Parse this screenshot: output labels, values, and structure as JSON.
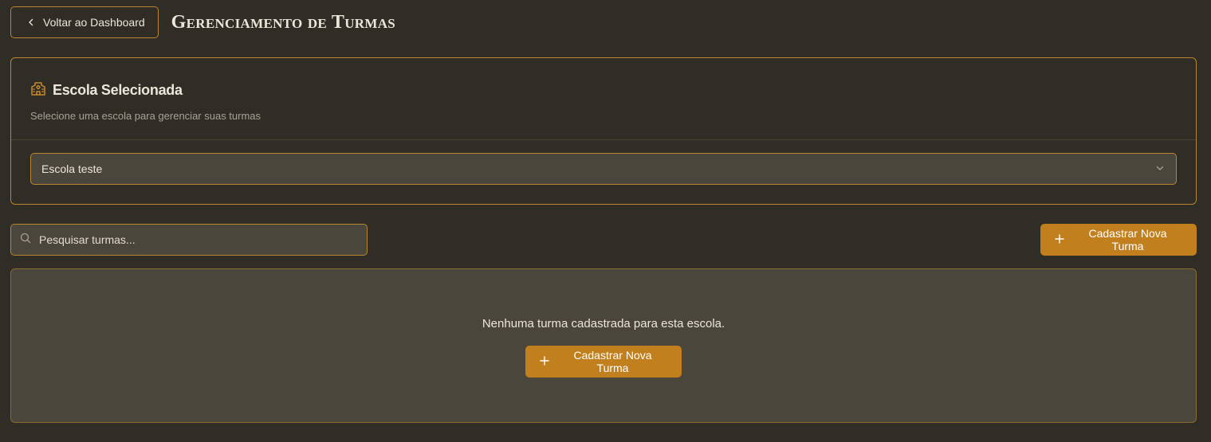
{
  "header": {
    "back_label": "Voltar ao Dashboard",
    "title": "Gerenciamento de Turmas"
  },
  "school_card": {
    "icon": "school-icon",
    "title": "Escola Selecionada",
    "description": "Selecione uma escola para gerenciar suas turmas",
    "select_value": "Escola teste"
  },
  "search": {
    "placeholder": "Pesquisar turmas..."
  },
  "toolbar": {
    "add_label": "Cadastrar Nova Turma"
  },
  "empty_state": {
    "message": "Nenhuma turma cadastrada para esta escola.",
    "add_label": "Cadastrar Nova Turma"
  },
  "colors": {
    "background": "#302d26",
    "accent": "#c17f1e",
    "border": "#b7862e",
    "panel": "#4a463c"
  }
}
